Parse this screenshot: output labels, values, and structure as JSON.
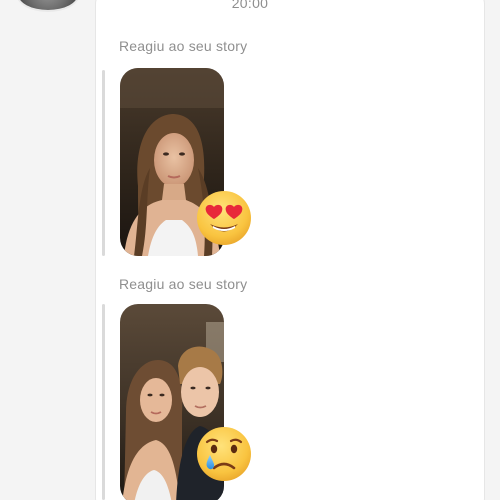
{
  "conversation": {
    "timestamp": "20:00",
    "messages": [
      {
        "caption": "Reagiu ao seu story",
        "story_thumbnail": "photo-girl-selfie",
        "reaction_emoji": "heart-eyes-emoji"
      },
      {
        "caption": "Reagiu ao seu story",
        "story_thumbnail": "photo-couple-selfie",
        "reaction_emoji": "crying-emoji"
      }
    ]
  },
  "colors": {
    "background": "#f4f4f4",
    "panel": "#ffffff",
    "caption_text": "#8f8f8f",
    "reply_bar": "#dadada",
    "emoji_yellow": "#f9c440"
  }
}
